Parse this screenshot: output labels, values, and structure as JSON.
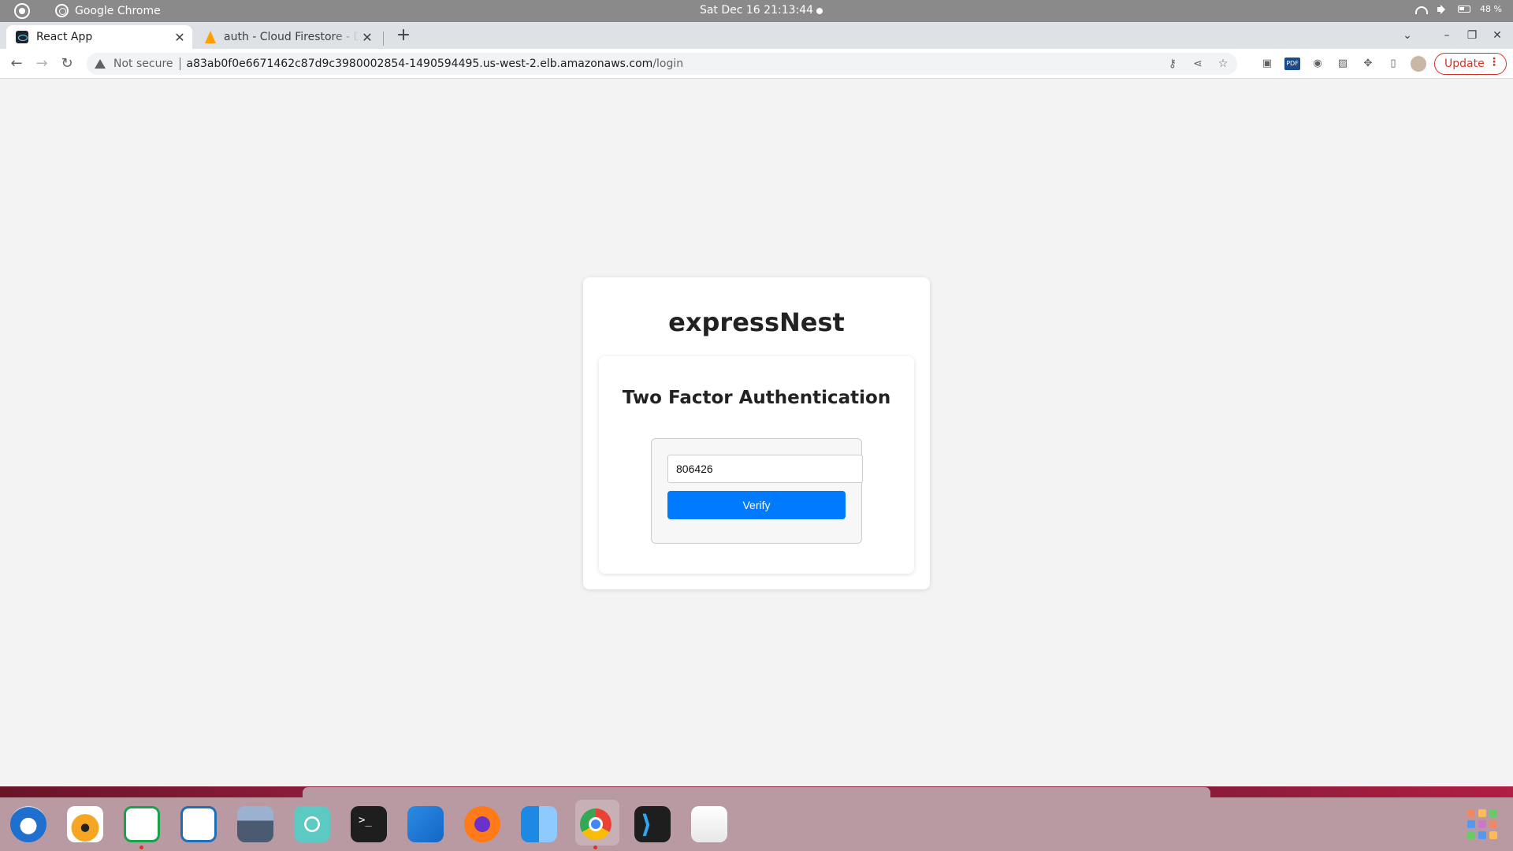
{
  "topbar": {
    "app_name": "Google Chrome",
    "clock": "Sat Dec 16  21:13:44",
    "battery": "48 %"
  },
  "tabs": [
    {
      "title": "React App",
      "icon": "react-icon",
      "active": true
    },
    {
      "title": "auth - Cloud Firestore - Da",
      "icon": "firebase-icon",
      "active": false
    }
  ],
  "omnibox": {
    "security_label": "Not secure",
    "url_host": "a83ab0f0e6671462c87d9c3980002854-1490594495.us-west-2.elb.amazonaws.com",
    "url_path": "/login"
  },
  "toolbar": {
    "update_label": "Update"
  },
  "page": {
    "brand": "expressNest",
    "heading": "Two Factor Authentication",
    "code_value": "806426",
    "verify_label": "Verify"
  },
  "colors": {
    "accent_button": "#007bff",
    "update_red": "#d93025",
    "dock_bg": "#b99aa3"
  },
  "dock": {
    "items": [
      "thunderbird-icon",
      "rhythmbox-icon",
      "calc-icon",
      "writer-icon",
      "screenshot-icon",
      "help-icon",
      "terminal-icon",
      "app-center-icon",
      "firefox-icon",
      "finder-icon",
      "chrome-icon",
      "vscode-icon",
      "text-editor-icon",
      "show-apps-icon"
    ]
  }
}
